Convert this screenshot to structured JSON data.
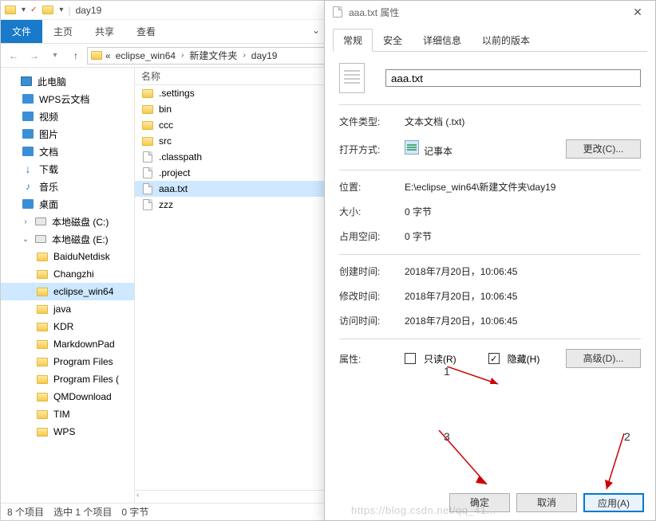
{
  "explorer": {
    "title": "day19",
    "ribbon": {
      "file": "文件",
      "home": "主页",
      "share": "共享",
      "view": "查看"
    },
    "breadcrumbs": {
      "lead": "«",
      "seg1": "eclipse_win64",
      "seg2": "新建文件夹",
      "seg3": "day19"
    },
    "list_header_name": "名称",
    "tree": {
      "thispc": "此电脑",
      "wpscloud": "WPS云文档",
      "videos": "视频",
      "pictures": "图片",
      "documents": "文档",
      "downloads": "下载",
      "music": "音乐",
      "desktop": "桌面",
      "drive_c": "本地磁盘 (C:)",
      "drive_e": "本地磁盘 (E:)",
      "e_children": [
        "BaiduNetdisk",
        "Changzhi",
        "eclipse_win64",
        "java",
        "KDR",
        "MarkdownPad",
        "Program Files",
        "Program Files (",
        "QMDownload",
        "TIM",
        "WPS"
      ]
    },
    "files": [
      {
        "name": ".settings",
        "type": "folder"
      },
      {
        "name": "bin",
        "type": "folder"
      },
      {
        "name": "ccc",
        "type": "folder"
      },
      {
        "name": "src",
        "type": "folder"
      },
      {
        "name": ".classpath",
        "type": "file"
      },
      {
        "name": ".project",
        "type": "file"
      },
      {
        "name": "aaa.txt",
        "type": "file",
        "selected": true
      },
      {
        "name": "zzz",
        "type": "file"
      }
    ],
    "status": {
      "items": "8 个项目",
      "selected": "选中 1 个项目",
      "size": "0 字节"
    }
  },
  "dialog": {
    "title": "aaa.txt 属性",
    "tabs": {
      "general": "常规",
      "security": "安全",
      "details": "详细信息",
      "previous": "以前的版本"
    },
    "filename": "aaa.txt",
    "labels": {
      "filetype": "文件类型:",
      "openwith": "打开方式:",
      "change": "更改(C)...",
      "location": "位置:",
      "size": "大小:",
      "sizeondisk": "占用空间:",
      "created": "创建时间:",
      "modified": "修改时间:",
      "accessed": "访问时间:",
      "attributes": "属性:",
      "readonly": "只读(R)",
      "hidden": "隐藏(H)",
      "advanced": "高级(D)...",
      "ok": "确定",
      "cancel": "取消",
      "apply": "应用(A)"
    },
    "values": {
      "filetype": "文本文档 (.txt)",
      "openwith": "记事本",
      "location": "E:\\eclipse_win64\\新建文件夹\\day19",
      "size": "0 字节",
      "sizeondisk": "0 字节",
      "created": "2018年7月20日，10:06:45",
      "modified": "2018年7月20日，10:06:45",
      "accessed": "2018年7月20日，10:06:45"
    }
  },
  "annotations": {
    "n1": "1",
    "n2": "2",
    "n3": "3"
  },
  "watermark": "https://blog.csdn.net/qq_41..."
}
